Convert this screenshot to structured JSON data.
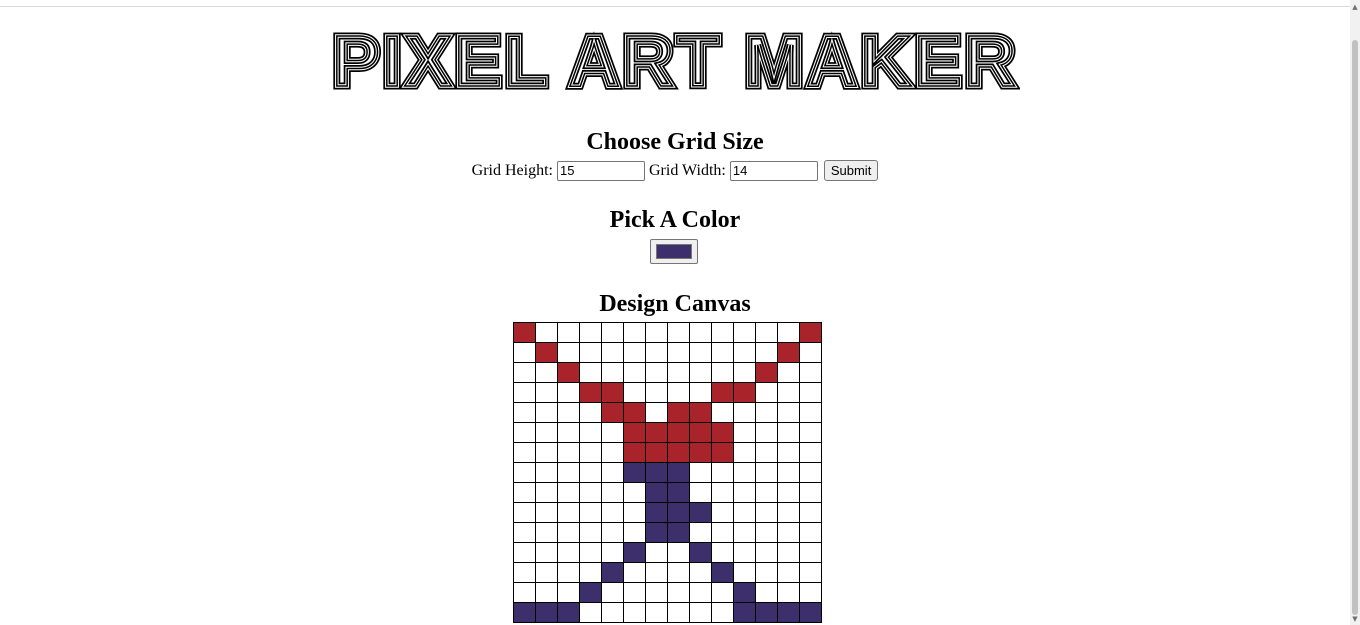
{
  "logo": {
    "text": "Pixel Art Maker"
  },
  "grid_size": {
    "title": "Choose Grid Size",
    "height_label": "Grid Height:",
    "height_value": "15",
    "width_label": "Grid Width:",
    "width_value": "14",
    "submit_label": "Submit"
  },
  "color": {
    "title": "Pick A Color",
    "selected": "#3d2f6b"
  },
  "canvas": {
    "title": "Design Canvas",
    "rows": 15,
    "cols": 14,
    "palette": {
      "R": "#a8232a",
      "B": "#3d2f6b",
      ".": "#ffffff"
    },
    "pixels": [
      "R............R",
      ".R..........R.",
      "..R........R..",
      "...RR....RR...",
      "....RR.RR.....",
      ".....RRRRR....",
      ".....RRRRR....",
      ".....BBB......",
      "......BB......",
      "......BBB.....",
      "......BB......",
      ".....B..B.....",
      "....B....B....",
      "...B......B...",
      "BBB.......BBBB"
    ]
  }
}
